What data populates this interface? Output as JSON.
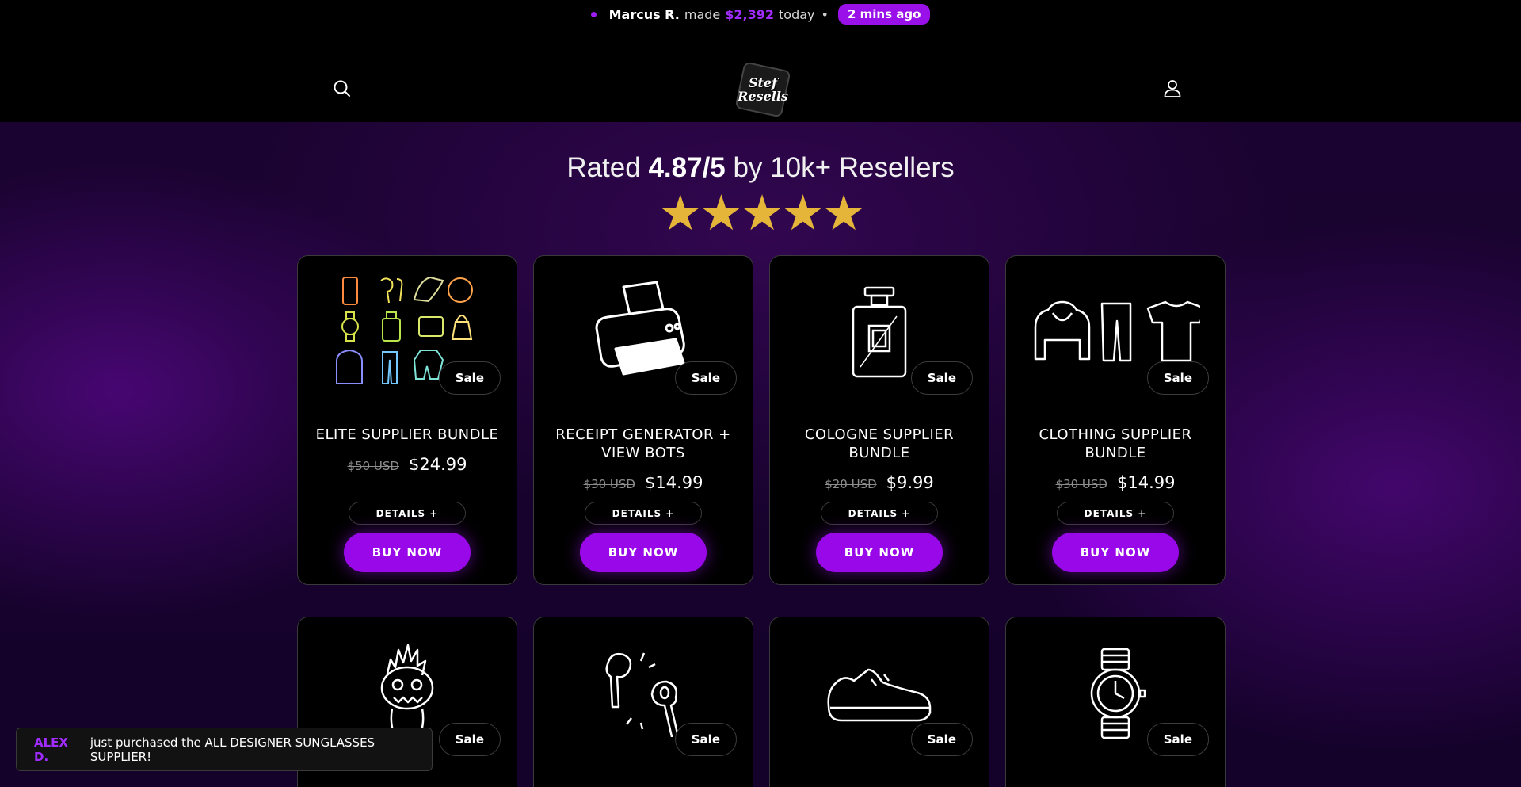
{
  "announcement": {
    "name": "Marcus R.",
    "verb": "made",
    "amount": "$2,392",
    "when": "today",
    "separator": "•",
    "pill": "2 mins ago"
  },
  "header": {
    "logo_line1": "Stef",
    "logo_line2": "Resells",
    "icons": [
      "search-icon",
      "account-icon"
    ]
  },
  "rating": {
    "prefix": "Rated",
    "score": "4.87/5",
    "suffix": "by 10k+ Resellers",
    "stars": "★★★★★",
    "stars_count": 5
  },
  "colors": {
    "accent": "#9808e9",
    "star": "#e5b53a",
    "background": "#000000"
  },
  "products": [
    {
      "title": "ELITE SUPPLIER BUNDLE",
      "old_price": "$50 USD",
      "price": "$24.99",
      "sale": "Sale",
      "details": "DETAILS +",
      "buy": "BUY NOW",
      "image": "bundle-icons-grid"
    },
    {
      "title": "RECEIPT GENERATOR + VIEW BOTS",
      "old_price": "$30 USD",
      "price": "$14.99",
      "sale": "Sale",
      "details": "DETAILS +",
      "buy": "BUY NOW",
      "image": "printer-icon"
    },
    {
      "title": "COLOGNE SUPPLIER BUNDLE",
      "old_price": "$20 USD",
      "price": "$9.99",
      "sale": "Sale",
      "details": "DETAILS +",
      "buy": "BUY NOW",
      "image": "perfume-bottle-icon"
    },
    {
      "title": "CLOTHING SUPPLIER BUNDLE",
      "old_price": "$30 USD",
      "price": "$14.99",
      "sale": "Sale",
      "details": "DETAILS +",
      "buy": "BUY NOW",
      "image": "clothing-icon"
    },
    {
      "sale": "Sale",
      "image": "monster-figure-icon"
    },
    {
      "sale": "Sale",
      "image": "earbuds-icon"
    },
    {
      "sale": "Sale",
      "image": "sneaker-icon"
    },
    {
      "sale": "Sale",
      "image": "watch-icon"
    }
  ],
  "toast": {
    "who": "ALEX D.",
    "message": "just purchased the ALL DESIGNER SUNGLASSES SUPPLIER!"
  }
}
